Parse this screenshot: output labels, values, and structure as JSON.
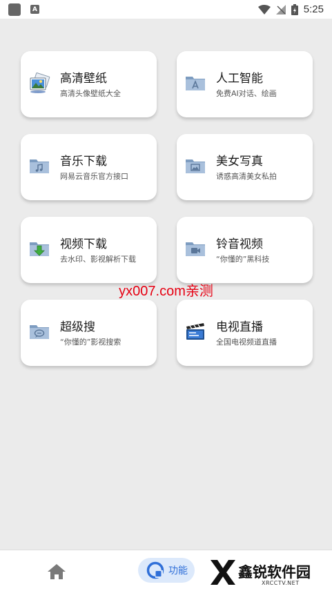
{
  "status_bar": {
    "time": "5:25",
    "app_icon_letter": "A"
  },
  "cards": [
    {
      "title": "高清壁纸",
      "subtitle": "高清头像壁纸大全",
      "icon": "wallpaper-icon"
    },
    {
      "title": "人工智能",
      "subtitle": "免费AI对话、绘画",
      "icon": "ai-folder-icon"
    },
    {
      "title": "音乐下载",
      "subtitle": "网易云音乐官方接口",
      "icon": "music-folder-icon"
    },
    {
      "title": "美女写真",
      "subtitle": "诱惑高清美女私拍",
      "icon": "picture-folder-icon"
    },
    {
      "title": "视频下载",
      "subtitle": "去水印、影视解析下载",
      "icon": "download-folder-icon"
    },
    {
      "title": "铃音视频",
      "subtitle": "“你懂的”黑科技",
      "icon": "video-folder-icon"
    },
    {
      "title": "超级搜",
      "subtitle": "“你懂的”影视搜索",
      "icon": "chat-folder-icon"
    },
    {
      "title": "电视直播",
      "subtitle": "全国电视频道直播",
      "icon": "clapperboard-icon"
    }
  ],
  "watermark": "yx007.com亲测",
  "bottom_nav": {
    "function_label": "功能"
  },
  "brand": {
    "name": "鑫锐软件园",
    "sub": "XRCCTV.NET"
  },
  "colors": {
    "accent": "#2f6fd8",
    "watermark": "#e60012",
    "background": "#ebebeb"
  }
}
